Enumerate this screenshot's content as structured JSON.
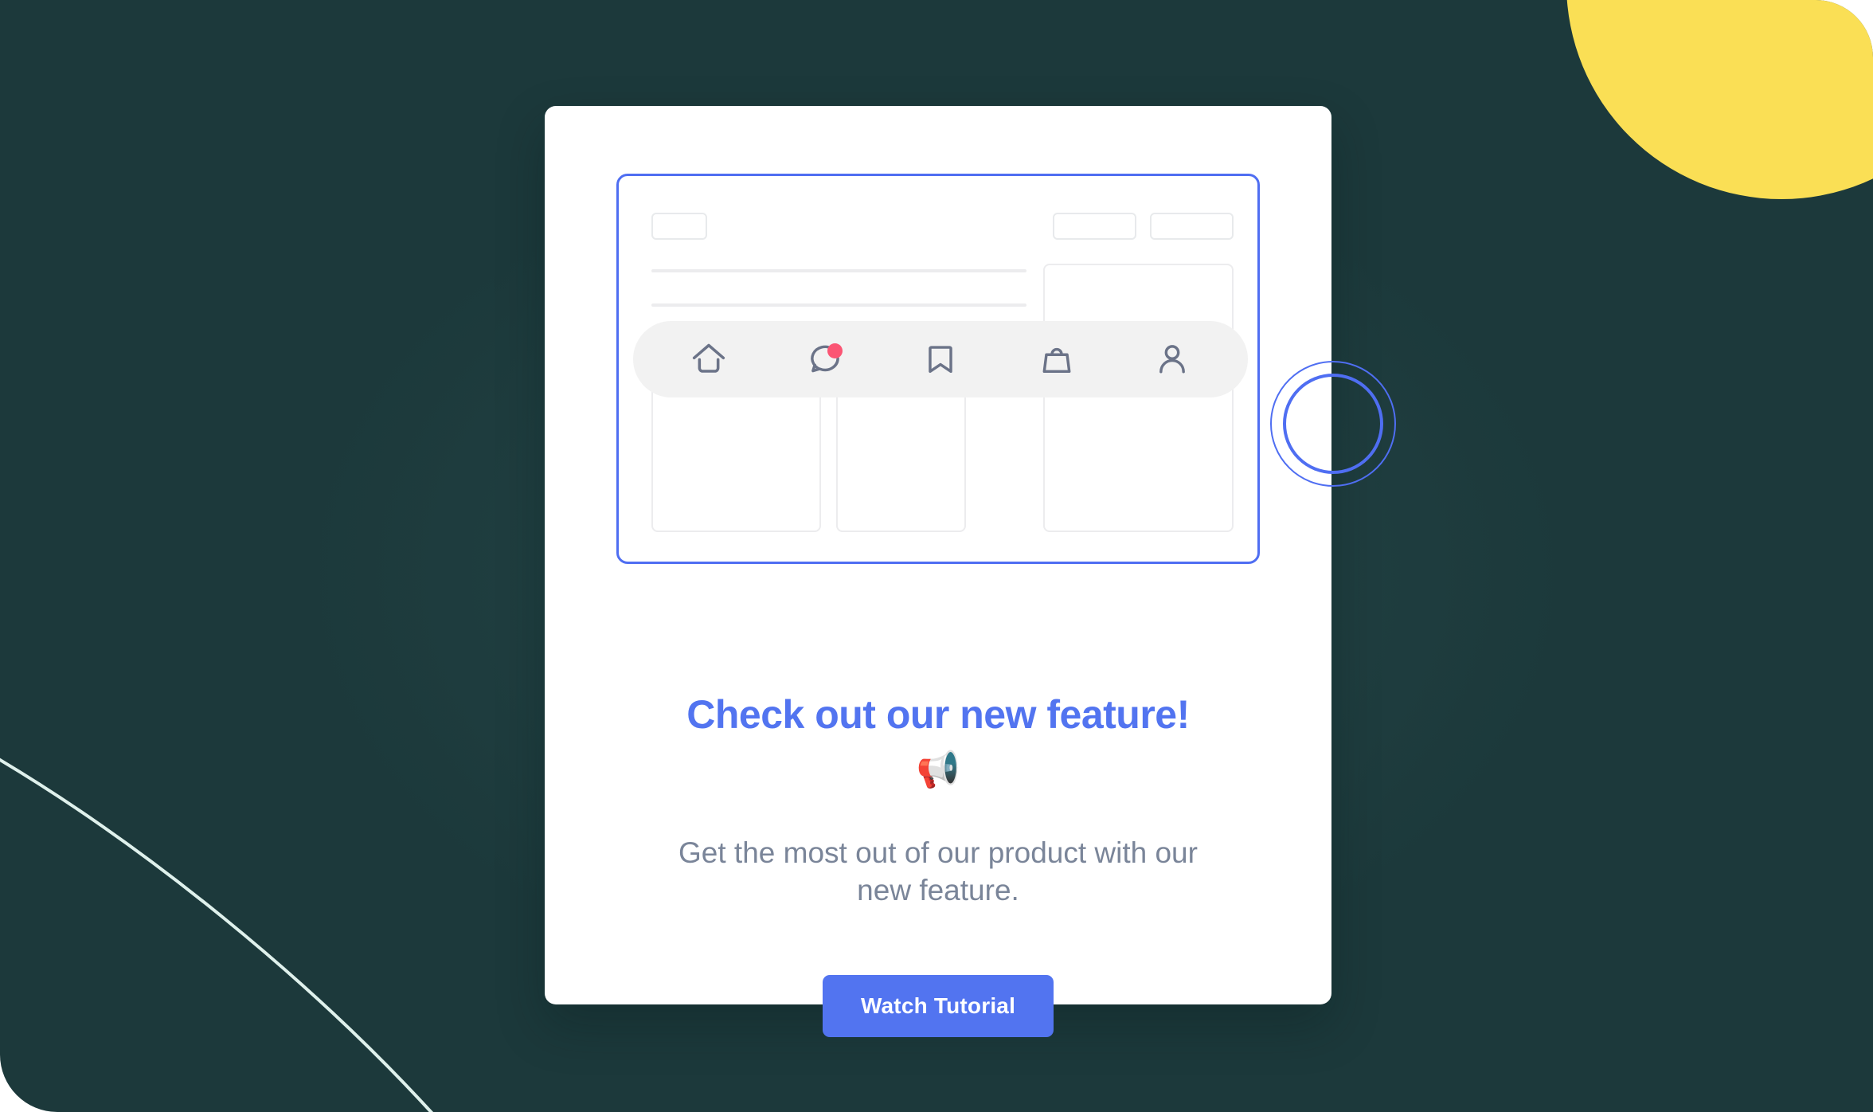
{
  "background": {
    "color": "#1c393b",
    "accent_circle_color": "#fadf55",
    "swoosh_color": "#dff1ec",
    "page_color": "#ffffff"
  },
  "card": {
    "background": "#ffffff",
    "illustration": {
      "frame_border_color": "#4f6ef2",
      "placeholder_chips": [
        {
          "name": "logo-placeholder"
        },
        {
          "name": "nav-placeholder-1"
        },
        {
          "name": "nav-placeholder-2"
        }
      ],
      "text_lines": [
        {
          "name": "text-line-1"
        },
        {
          "name": "text-line-2"
        },
        {
          "name": "text-line-3"
        }
      ],
      "panels": [
        {
          "name": "sidebar-panel"
        },
        {
          "name": "content-panel-1"
        },
        {
          "name": "content-panel-2"
        }
      ],
      "dock": {
        "background": "#f2f2f2",
        "items": [
          {
            "icon": "home-icon",
            "label": "Home",
            "active": false,
            "badge": false
          },
          {
            "icon": "chat-icon",
            "label": "Messages",
            "active": true,
            "badge": true
          },
          {
            "icon": "bookmark-icon",
            "label": "Saved",
            "active": false,
            "badge": false
          },
          {
            "icon": "bag-icon",
            "label": "Shop",
            "active": false,
            "badge": false
          },
          {
            "icon": "person-icon",
            "label": "Profile",
            "active": false,
            "badge": false
          }
        ],
        "badge_color": "#fb5574",
        "highlight_ring_color": "#4f6ef2"
      }
    },
    "headline": "Check out our new feature!",
    "headline_color": "#5274f0",
    "emoji": "📢",
    "emoji_name": "loudspeaker",
    "subtext": "Get the most out of our product with our new feature.",
    "subtext_color": "#7a8599",
    "cta": {
      "label": "Watch Tutorial",
      "background": "#5274f0",
      "text_color": "#ffffff"
    }
  }
}
